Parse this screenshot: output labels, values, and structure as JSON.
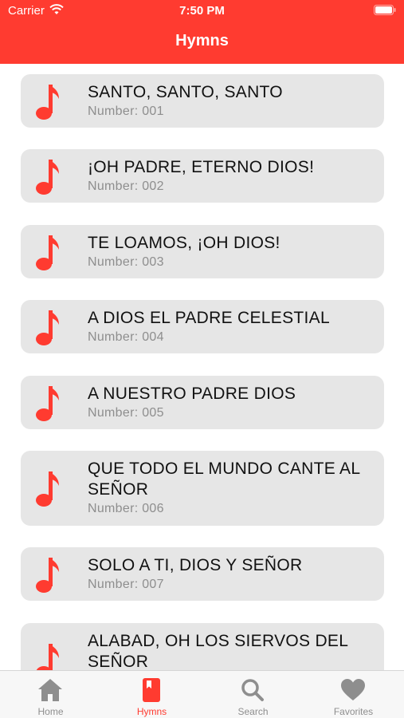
{
  "status_bar": {
    "carrier": "Carrier",
    "time": "7:50 PM"
  },
  "nav": {
    "title": "Hymns"
  },
  "hymns": [
    {
      "title": "SANTO, SANTO, SANTO",
      "number": "Number: 001"
    },
    {
      "title": "¡OH PADRE, ETERNO DIOS!",
      "number": "Number: 002"
    },
    {
      "title": "TE LOAMOS, ¡OH DIOS!",
      "number": "Number: 003"
    },
    {
      "title": "A DIOS EL PADRE CELESTIAL",
      "number": "Number: 004"
    },
    {
      "title": "A NUESTRO PADRE DIOS",
      "number": "Number: 005"
    },
    {
      "title": "QUE TODO EL MUNDO CANTE AL SEÑOR",
      "number": "Number: 006"
    },
    {
      "title": "SOLO A TI, DIOS Y SEÑOR",
      "number": "Number: 007"
    },
    {
      "title": "ALABAD, OH LOS SIERVOS DEL SEÑOR",
      "number": ""
    }
  ],
  "tabs": [
    {
      "label": "Home",
      "icon": "house-icon"
    },
    {
      "label": "Hymns",
      "icon": "book-icon",
      "active": true
    },
    {
      "label": "Search",
      "icon": "search-icon"
    },
    {
      "label": "Favorites",
      "icon": "heart-icon"
    }
  ],
  "colors": {
    "accent": "#ff3b30",
    "card": "#e6e6e6",
    "muted": "#8e8e8e"
  }
}
